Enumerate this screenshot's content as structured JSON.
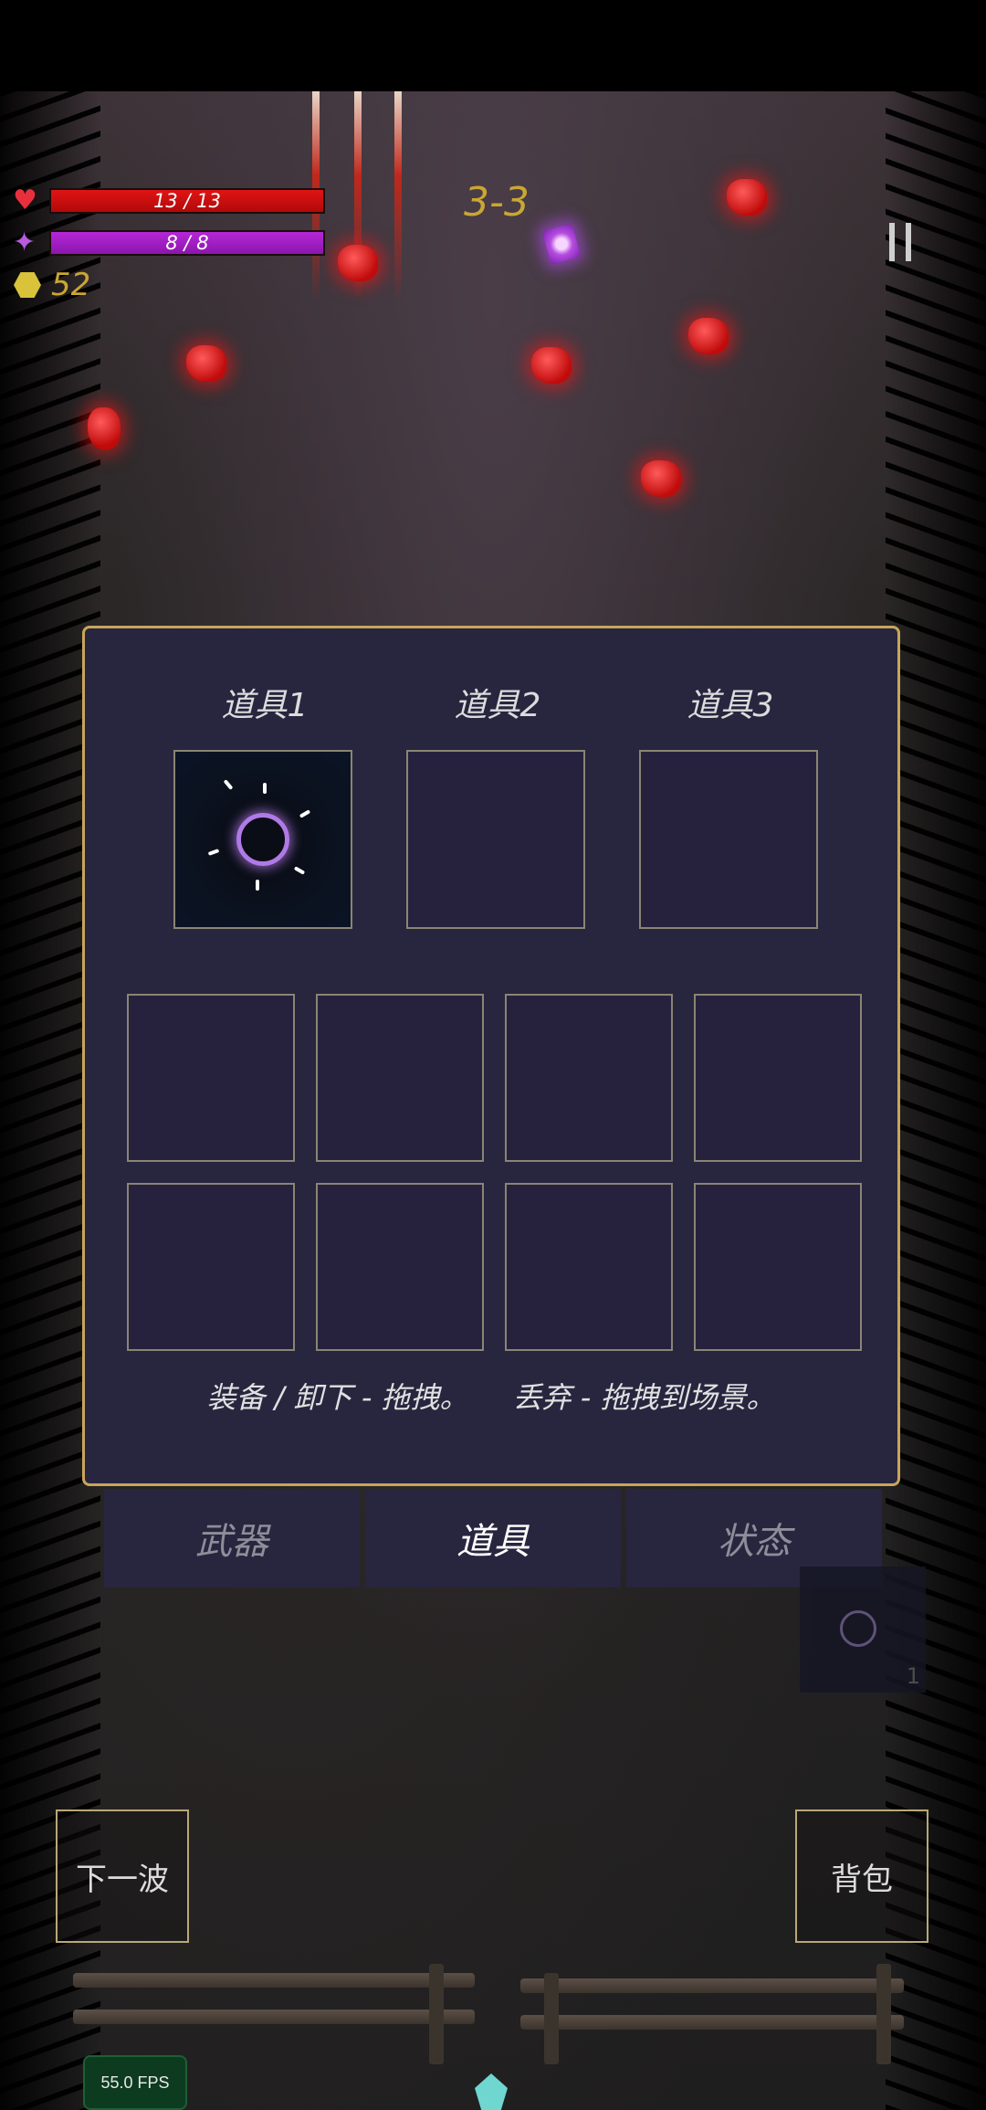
{
  "hud": {
    "hp_text": "13 / 13",
    "mp_text": "8 / 8",
    "coins": "52",
    "wave": "3-3",
    "hp_fraction": 1.0,
    "mp_fraction": 1.0
  },
  "panel": {
    "slot_titles": [
      "道具1",
      "道具2",
      "道具3"
    ],
    "hint_equip": "装备 / 卸下 - 拖拽。",
    "hint_drop": "丢弃 - 拖拽到场景。"
  },
  "tabs": [
    {
      "label": "武器",
      "active": false
    },
    {
      "label": "道具",
      "active": true
    },
    {
      "label": "状态",
      "active": false
    }
  ],
  "ghost_item": {
    "count": "1"
  },
  "buttons": {
    "next_wave": "下一波",
    "bag": "背包"
  },
  "fps": "55.0 FPS",
  "colors": {
    "hp": "#e01414",
    "mp": "#b627d8",
    "coin": "#c9a733",
    "panel_border": "#c8a55a",
    "panel_bg": "#28253f"
  },
  "icons": {
    "hp": "heart-icon",
    "mp": "mana-icon",
    "coin": "coin-icon",
    "pause": "pause-icon"
  }
}
